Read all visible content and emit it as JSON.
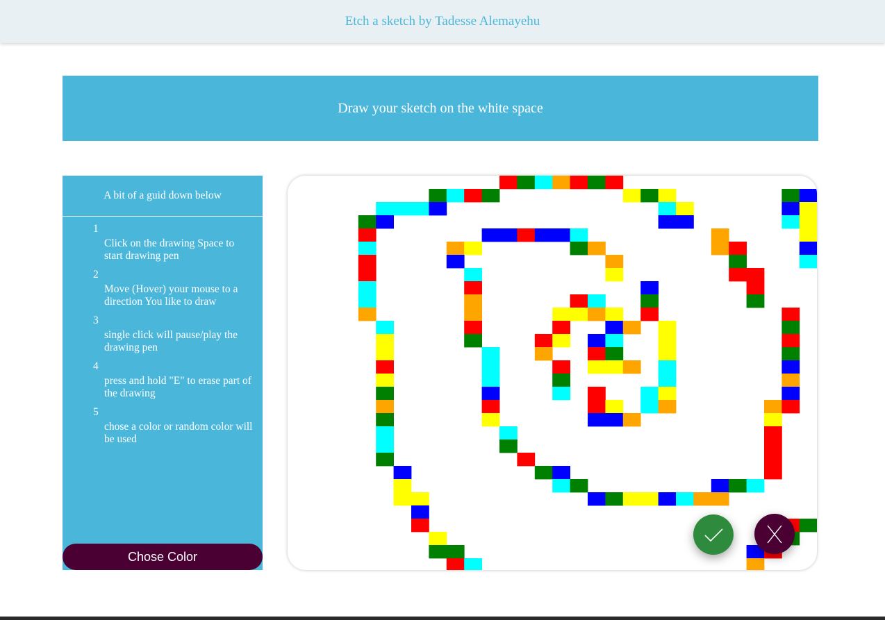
{
  "header": {
    "title": "Etch a sketch by Tadesse Alemayehu"
  },
  "banner": {
    "text": "Draw your sketch on the white space"
  },
  "guide": {
    "title": "A bit of a guid down below",
    "steps": [
      {
        "num": "1",
        "text": "Click on the drawing Space to start drawing pen"
      },
      {
        "num": "2",
        "text": "Move (Hover) your mouse to a direction You like to draw"
      },
      {
        "num": "3",
        "text": "single click will pause/play the drawing pen"
      },
      {
        "num": "4",
        "text": "press and hold \"E\" to erase part of the drawing"
      },
      {
        "num": "5",
        "text": "chose a color or random color will be used"
      }
    ],
    "color_button": "Chose Color"
  },
  "actions": {
    "confirm_icon": "check-icon",
    "close_icon": "close-icon"
  },
  "palette": {
    "R": "#ff0000",
    "G": "#008000",
    "B": "#0000ff",
    "Y": "#ffff00",
    "C": "#00ffff",
    "O": "#ffa500"
  },
  "canvas_grid": {
    "rows": [
      "..........RGCORGR.............................",
      "......GCRG.......YGY......GBO.................",
      "...CCCB............CY.....BYCB................",
      "..GB...............BB.....CYO.................",
      "..R......BBRBBC.......O....Y..................",
      "..C....OY.....GO......OR...BC.................",
      "..R....B........O......G...CGB................",
      "..R.....C.......Y......RR...YO................",
      "..C.....R.........B.....R...ROO...............",
      "..C.....O.....RC..G.....G...OCO...............",
      "..O.....O....YYOY.R.......R..YCR..............",
      "...C....R....R..BO.Y......G..O.R..............",
      "...Y....G...RY.BC..Y......R..Y.G..............",
      "...Y.....C..O..RG..Y......G..O.Y..............",
      "...R.....C...R.YYO.C......B..G.G..............",
      "...Y.....C...G.....C......O.BBY.G.............",
      "...G.....B...C.R..CY......B.....B.............",
      "...O.....R.....RY.CO.....OR.....G.............",
      "...G.....Y.....BBO.......Y......O.............",
      "...C......C..............R.....R..............",
      "...C......G..............R.....Y..............",
      "...G.......R.............R....RO..............",
      "....B.......GB...........R...RB...............",
      "....Y........CG.......BGC...YR................",
      "....YY.........BGYYBCOO.....G.................",
      ".....B......................CB................",
      ".....R....................RG..................",
      "......Y..................RG...................",
      "......GG................BR....................",
      ".......RC...............O....................."
    ]
  }
}
